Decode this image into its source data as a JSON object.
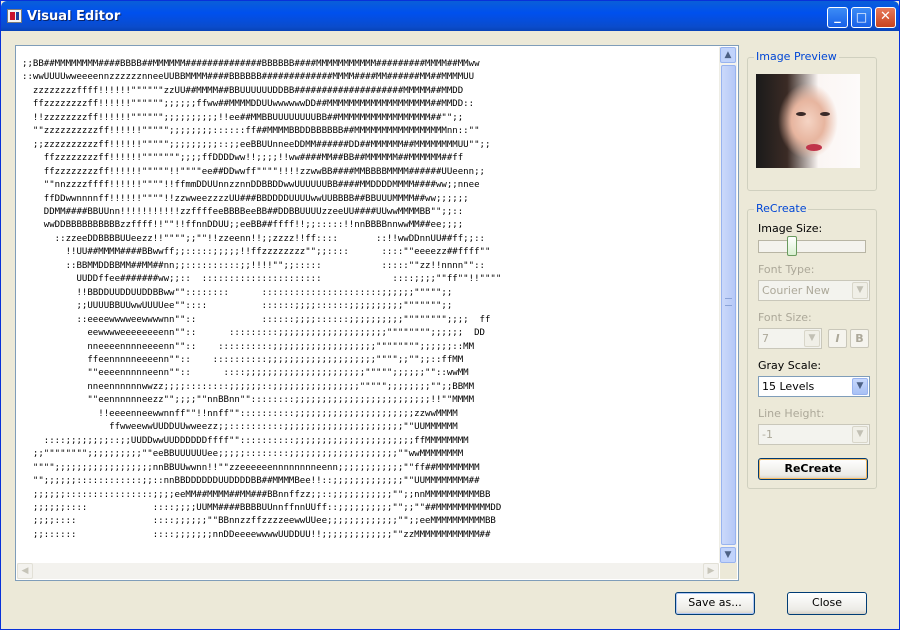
{
  "window": {
    "title": "Visual Editor",
    "controls": {
      "minimize": "_",
      "maximize": "□",
      "close": "✕"
    }
  },
  "ascii_art": [
    ";;BB##MMMMMMMM####BBBB##MMMMMM##############BBBBBB####MMMMMMMMMMM#########MMMM##MMww",
    "::wwUUUUwweeeennzzzzzznneeUUBBMMMM####BBBBBB#############MMMM####MM######MM##MMMMUU",
    "  zzzzzzzzffff!!!!!!\"\"\"\"\"\"zzUU##MMMM##BBUUUUUUDDBB####################MMMMM##MMDD",
    "  ffzzzzzzzzff!!!!!!\"\"\"\"\"\";;;;;;ffww##MMMMDDUUwwwwwwDD##MMMMMMMMMMMMMMMMMMM##MMDD::",
    "  !!zzzzzzzzff!!!!!!\"\"\"\"\"\";;;;;;;;;;!!ee##MMBBUUUUUUUUBB##MMMMMMMMMMMMMMMMM##\"\";;",
    "  \"\"zzzzzzzzzzff!!!!!!\"\"\"\"\";;;;;;;;::::::ff##MMMMBBDDBBBBBB##MMMMMMMMMMMMMMMMMnn::\"\"",
    "  ;;zzzzzzzzzzff!!!!!!\"\"\"\"\";;;;;;;;;::;;eeBBUUnneeDDMM######DD##MMMMMM##MMMMMMMMUU\"\";;",
    "    ffzzzzzzzzff!!!!!!\"\"\"\"\"\"\";;;;ffDDDDww!!;;;;!!ww####MM##BB##MMMMMM##MMMMMM##ff",
    "    ffzzzzzzzzff!!!!!!\"\"\"\"\"!!\"\"\"\"ee##DDwwff\"\"\"\"!!!!zzwwBB####MMBBBBMMMM######UUeenn;;",
    "    \"\"nnzzzzffff!!!!!!\"\"\"\"!!ffmmDDUUnnzznnDDBBDDwwUUUUUUBB####MMDDDDMMMM####ww;;nnee",
    "    ffDDwwnnnnff!!!!!!\"\"\"\"!!zzwweezzzzUU###BBDDDDUUUUwwUUBBBB##BBUUUMMMM##ww;;;;;;",
    "    DDMM####BBUUnn!!!!!!!!!!!zzffffeeBBBBeeBB##DDBBUUUUzzeeUU####UUwwMMMMBB\"\";;::",
    "    wwDDBBBBBBBBBBzzffff!!\"\"!!ffnnDDUU;;eeBB##ffff!!;;:::::!!nnBBBBnnwwMM##ee;;;;",
    "      ::zzeeDDBBBBUUeezz!!\"\"\"\";;\"\"!!zzeenn!!;;zzzz!!ff::::       ::!!wwDDnnUU##ff;;::",
    "        !!UU##MMMM####BBwwff;;:::::;;;;;!!ffzzzzzzzz\"\";;::::      ::::\"\"eeeezz##ffff\"\"",
    "        ::BBMMDDBBMM##MM##nn;;::::::::::;;!!!!\"\";;:::::           :::::\"\"zz!!nnnn\"\"::",
    "          UUDDffee#######ww;;::  ::::::::::::::::::::::             ::::;;;;\"\"ff\"\"!!\"\"\"\"",
    "          !!BBDDUUDDUUDDBBww\"\"::::::::      ::::::::::::::::::::::;;;;;;\"\"\"\"\";;",
    "          ;;UUUUBBUUwwUUUUee\"\"::::          ::::::;;;;::::::;;;;;;;;;;\"\"\"\"\"\"\";;",
    "          ::eeeewwwweewwwwnn\"\"::            ::::::;;;;::::::;;;;;;;;;;\"\"\"\"\"\"\"\";;;;  ff",
    "            eewwwweeeeeeeenn\"\"::      :::::::::;;;;;;;;;;;;;;;;;;;;\"\"\"\"\"\"\"\";;;;;;  DD",
    "            nneeeennnneeeenn\"\"::    ::::::::::;;;;;;;;;;;;;;;;;;;\"\"\"\"\"\"\"\";;;;;;::MM",
    "            ffeennnnneeeenn\"\"::    ::::::::::;;;;;;;;;;;;;;;;;;;;\"\"\"\";;\"\";;::ffMM",
    "            \"\"eeeennnnneenn\"\"::      ::::;;;;;;;;;;;;;;;;;;;;;;\"\"\"\"\";;;;;;\"\"::wwMM",
    "            nneennnnnnwwzz;;;;::::::::;;;;;;::;;;;;;;;;;;;;;;;\"\"\"\"\";;;;;;;;\"\";;BBMM",
    "            \"\"eennnnnneezz\"\";;;;\"\"nnBBnn\"\"::::::::;;;;;;;;;;;;;;;;;;;;;;;;;!!\"\"MMMM",
    "              !!eeeenneewwnnff\"\"!!nnff\"\"::::::::::;;;;;;;;;;;;;;;;;;;;;;zzwwMMMM",
    "                ffwweewwUUDDUUwweezz;;::::::::::;;;;;;;;;;;;;;;;;;;;;;\"\"UUMMMMMM",
    "    ::::;;;;;;;;::;;UUDDwwUUDDDDDDffff\"\"::::::::::;;;;;;;;;;;;;;;;;;;;;;ffMMMMMMMM",
    "  ;;\"\"\"\"\"\"\"\";;;;;;;;;;\"\"eeBBUUUUUUee;;;;;::::::::;;;;;;;;;;;;;;;;;;;;\"\"wwMMMMMMMM",
    "  \"\"\"\";;;;;;;;;;;;;;;;;;nnBBUUwwnn!!\"\"zzeeeeeennnnnnnneenn;;;;;;;;;;;;\"\"ff##MMMMMMMM",
    "  \"\";;;;;;::::::::::::;;::nnBBDDDDDDUUDDDDBB##MMMMBee!!::;;;;;;;;;;;;;\"\"UUMMMMMMMM##",
    "  ;;;;;;::::::::::::::::;;;;eeMM##MMMM##MM###BBnnffzz;;::;;;;;;;;;;;\"\";;nnMMMMMMMMMMBB",
    "  ;;;;;;::::            ::::;;;;UUMM####BBBBUUnnffnnUUff::;;;;;;;;;;\"\";;\"\"##MMMMMMMMMMDD",
    "  ;;;;::::              ::::;;;;;;\"\"BBnnzzffzzzzeewwUUee;;;;;;;;;;;;;\"\";;eeMMMMMMMMMMBB",
    "  ;;::::::              ::::;;;;;;;nnDDeeeewwwwUUDDUU!!;;;;;;;;;;;;;\"\"zzMMMMMMMMMMMM##"
  ],
  "panel": {
    "preview_title": "Image Preview",
    "recreate_title": "ReCreate",
    "image_size_label": "Image Size:",
    "image_size_value": 0.3,
    "font_label": "Font Type:",
    "font_value": "Courier New",
    "font_size_label": "Font Size:",
    "font_size_value": "7",
    "italic_label": "I",
    "bold_label": "B",
    "gray_label": "Gray Scale:",
    "gray_value": "15 Levels",
    "line_height_label": "Line Height:",
    "line_height_value": "-1",
    "recreate_button": "ReCreate"
  },
  "footer": {
    "save_button": "Save as...",
    "close_button": "Close"
  },
  "icons": {
    "scroll_up": "up-arrow-icon",
    "scroll_down": "down-arrow-icon",
    "scroll_left": "left-arrow-icon",
    "scroll_right": "right-arrow-icon",
    "combo_arrow": "chevron-down-icon"
  },
  "colors": {
    "title_bar": "#0054e3",
    "group_label": "#0046d5",
    "disabled_text": "#aca899",
    "window_bg": "#ece9d8"
  }
}
